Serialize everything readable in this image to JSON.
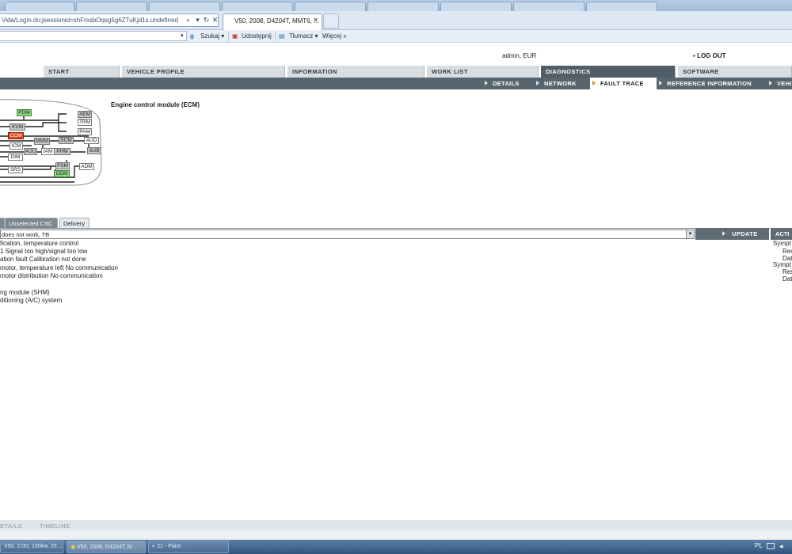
{
  "browser": {
    "address": "Vida/Login.do;jsessionid=shFrssbOqsg5g6ZTuKjd1s.undefined",
    "active_tab": "V50, 2008, D4204T, MMT6, ...",
    "toolbar": {
      "search_label": "Szukaj",
      "share_label": "Udostępnij",
      "translate_label": "Tłumacz",
      "more_label": "Więcej"
    }
  },
  "header": {
    "user": "admin, EUR",
    "logout": "LOG OUT"
  },
  "main_tabs": [
    {
      "label": "START"
    },
    {
      "label": "VEHICLE PROFILE"
    },
    {
      "label": "INFORMATION"
    },
    {
      "label": "WORK LIST"
    },
    {
      "label": "DIAGNOSTICS"
    },
    {
      "label": "SOFTWARE"
    }
  ],
  "sub_tabs": [
    {
      "label": "DETAILS"
    },
    {
      "label": "NETWORK"
    },
    {
      "label": "FAULT TRACE"
    },
    {
      "label": "REFERENCE INFORMATION"
    },
    {
      "label": "VEHI"
    }
  ],
  "network": {
    "title": "Engine control module (ECM)",
    "nodes": [
      "PDM",
      "AEM",
      "KVM",
      "TRM",
      "PAM",
      "CCM",
      "ICM",
      "MMM",
      "SCM",
      "AUD",
      "AUU",
      "IAM",
      "PHM",
      "SUB",
      "DIM",
      "PSM",
      "ADM",
      "SRS",
      "DDM"
    ]
  },
  "lower_tabs": [
    {
      "label": "Unselected CSC"
    },
    {
      "label": "Delivery"
    }
  ],
  "csc_select": "does not work, TB",
  "update_label": "UPDATE",
  "actions_header": "ACTI",
  "csc_lines": [
    "fication, temperature control",
    "1 Signal too high/signal too low",
    "ation fault Calibration not done",
    "motor, temperature left No communication",
    "motor distribution No communication",
    "ng module (SHM)",
    "ditioning (A/C) system"
  ],
  "actions": [
    "Sympt",
    "Res",
    "Dat",
    "Sympt",
    "Res",
    "Dat"
  ],
  "footer_tabs": [
    "ETAILS",
    "TIMELINE"
  ],
  "taskbar": [
    {
      "label": "V50, 2.0D, 100kw, 20..."
    },
    {
      "label": "V50, 2008, D4204T, M..."
    },
    {
      "label": "21 - Paint"
    }
  ],
  "tray": {
    "lang": "PL"
  },
  "colors": {
    "dark_bar": "#58656e",
    "active_fault": "#e04a22",
    "ok_node": "#8edb85",
    "accent": "#e38a1f"
  }
}
